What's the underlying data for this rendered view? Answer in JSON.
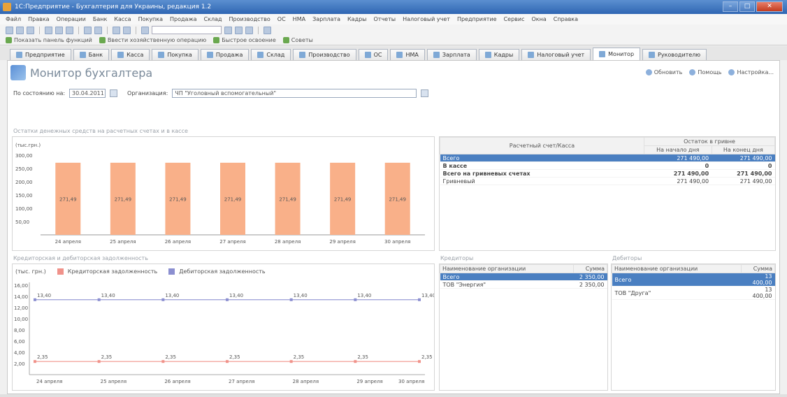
{
  "window": {
    "title": "1С:Предприятие - Бухгалтерия для Украины, редакция 1.2"
  },
  "menu": [
    "Файл",
    "Правка",
    "Операции",
    "Банк",
    "Касса",
    "Покупка",
    "Продажа",
    "Склад",
    "Производство",
    "ОС",
    "НМА",
    "Зарплата",
    "Кадры",
    "Отчеты",
    "Налоговый учет",
    "Предприятие",
    "Сервис",
    "Окна",
    "Справка"
  ],
  "funcbar": {
    "panel": "Показать панель функций",
    "quick": "Ввести хозяйственную операцию",
    "tips": "Быстрое освоение",
    "advice": "Советы"
  },
  "tabs": [
    "Предприятие",
    "Банк",
    "Касса",
    "Покупка",
    "Продажа",
    "Склад",
    "Производство",
    "ОС",
    "НМА",
    "Зарплата",
    "Кадры",
    "Налоговый учет",
    "Монитор",
    "Руководителю"
  ],
  "active_tab": "Монитор",
  "monitor": {
    "title": "Монитор бухгалтера",
    "actions": {
      "refresh": "Обновить",
      "help": "Помощь",
      "settings": "Настройка..."
    }
  },
  "filters": {
    "date_label": "По состоянию на:",
    "date_value": "30.04.2011",
    "org_label": "Организация:",
    "org_value": "ЧП \"Уголовный вспомогательный\""
  },
  "balance_section": {
    "title": "Остатки денежных средств на расчетных счетах и в кассе",
    "table": {
      "col_account": "Расчетный счет/Касса",
      "col_group": "Остаток в гривне",
      "col_start": "На начало дня",
      "col_end": "На конец дня",
      "rows": [
        {
          "name": "Всего",
          "start": "271 490,00",
          "end": "271 490,00",
          "style": "sel"
        },
        {
          "name": "В кассе",
          "start": "0",
          "end": "0",
          "style": "bold"
        },
        {
          "name": "Всего на гривневых счетах",
          "start": "271 490,00",
          "end": "271 490,00",
          "style": "bold"
        },
        {
          "name": "Гривневый",
          "start": "271 490,00",
          "end": "271 490,00",
          "style": ""
        }
      ]
    }
  },
  "debt_section": {
    "title": "Кредиторская и дебиторская задолженность",
    "legend": {
      "credit": "Кредиторская задолженность",
      "debit": "Дебиторская задолженность"
    }
  },
  "creditors": {
    "title": "Кредиторы",
    "col_name": "Наименование организации",
    "col_sum": "Сумма",
    "rows": [
      {
        "name": "Всего",
        "sum": "2 350,00",
        "style": "sel"
      },
      {
        "name": "ТОВ \"Энергия\"",
        "sum": "2 350,00",
        "style": ""
      }
    ]
  },
  "debtors": {
    "title": "Дебиторы",
    "col_name": "Наименование организации",
    "col_sum": "Сумма",
    "rows": [
      {
        "name": "Всего",
        "sum": "13 400,00",
        "style": "sel"
      },
      {
        "name": "ТОВ \"Друга\"",
        "sum": "13 400,00",
        "style": ""
      }
    ]
  },
  "colors": {
    "bar": "#f9b089",
    "credit": "#f0928a",
    "debit": "#8b8fd0",
    "selected": "#4a7fc1"
  },
  "chart_data": [
    {
      "type": "bar",
      "ylabel": "(тыс.грн.)",
      "ylim": [
        0,
        300
      ],
      "yticks": [
        "300,00",
        "250,00",
        "200,00",
        "150,00",
        "100,00",
        "50,00"
      ],
      "categories": [
        "24 апреля",
        "25 апреля",
        "26 апреля",
        "27 апреля",
        "28 апреля",
        "29 апреля",
        "30 апреля"
      ],
      "values": [
        271.49,
        271.49,
        271.49,
        271.49,
        271.49,
        271.49,
        271.49
      ],
      "data_labels": [
        "271,49",
        "271,49",
        "271,49",
        "271,49",
        "271,49",
        "271,49",
        "271,49"
      ]
    },
    {
      "type": "line",
      "ylabel": "(тыс. грн.)",
      "ylim": [
        0,
        16
      ],
      "yticks": [
        "16,00",
        "14,00",
        "12,00",
        "10,00",
        "8,00",
        "6,00",
        "4,00",
        "2,00"
      ],
      "categories": [
        "24 апреля",
        "25 апреля",
        "26 апреля",
        "27 апреля",
        "28 апреля",
        "29 апреля",
        "30 апреля"
      ],
      "series": [
        {
          "name": "Кредиторская задолженность",
          "values": [
            2.35,
            2.35,
            2.35,
            2.35,
            2.35,
            2.35,
            2.35
          ],
          "labels": [
            "2,35",
            "2,35",
            "2,35",
            "2,35",
            "2,35",
            "2,35",
            "2,35"
          ]
        },
        {
          "name": "Дебиторская задолженность",
          "values": [
            13.4,
            13.4,
            13.4,
            13.4,
            13.4,
            13.4,
            13.4
          ],
          "labels": [
            "13,40",
            "13,40",
            "13,40",
            "13,40",
            "13,40",
            "13,40",
            "13,40"
          ]
        }
      ]
    }
  ]
}
